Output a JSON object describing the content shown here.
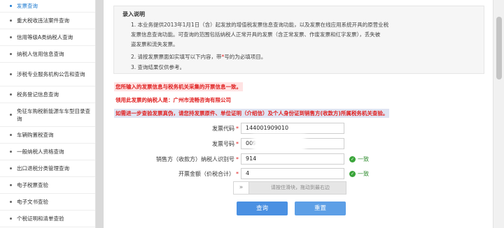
{
  "sidebar": {
    "items": [
      {
        "label": "发票查询",
        "active": true
      },
      {
        "label": "重大税收违法案件查询",
        "active": false
      },
      {
        "label": "信用等级A类纳税人查询",
        "active": false
      },
      {
        "label": "纳税人信用信息查询",
        "active": false
      },
      {
        "label": "涉税专业服务机构公告和查询",
        "active": false
      },
      {
        "label": "税务登记信息查询",
        "active": false
      },
      {
        "label": "免征车购税新能源车车型目录查询",
        "active": false
      },
      {
        "label": "车辆购置税查询",
        "active": false
      },
      {
        "label": "一般纳税人资格查询",
        "active": false
      },
      {
        "label": "出口退税分类管理查询",
        "active": false
      },
      {
        "label": "电子税票查验",
        "active": false
      },
      {
        "label": "电子文书查验",
        "active": false
      },
      {
        "label": "个税证明和清单查验",
        "active": false
      }
    ]
  },
  "notice": {
    "title": "录入说明",
    "line1": "1. 本业务提供2013年1月1日（含）起发放的增值税发票信息查询功能，以及发票在线应用系统开具的原营业税",
    "line2": "发票信息查询功能。可查询的范围包括纳税人正常开具的发票（含正常发票、作废发票和红字发票），丢失被",
    "line3": "盗发票和流失发票。",
    "line4_pre": "2. 请按发票票面如实填写以下内容，带",
    "line4_star": "*",
    "line4_post": "号的为必填项目。",
    "line5": "3. 查询结果仅供参考。"
  },
  "warnings": {
    "w1": "您所输入的发票信息与税务机关采集的开票信息一致。",
    "w2": "领用此发票的纳税人是：广州市流畅咨询有限公司",
    "w3": "如需进一步查验发票真伪，请您持发票原件、单位证明（介绍信）及个人身份证到销售方(收款方)所属税务机关查验。"
  },
  "form": {
    "invoice_code_label": "发票代码",
    "invoice_code_value": "144001909010",
    "invoice_number_label": "发票号码",
    "invoice_number_value": "009",
    "seller_id_label": "销售方（收款方）纳税人识别号",
    "seller_id_value": "914",
    "amount_label": "开票金额（价税合计）",
    "amount_value": "4",
    "required_star": "*",
    "match_text": "一致"
  },
  "slider": {
    "handle_glyph": "»",
    "hint": "请按住滑块，拖动到最右边"
  },
  "buttons": {
    "query": "查询",
    "reset": "重置"
  },
  "colors": {
    "accent": "#4a90e2",
    "warning": "#e02020",
    "ok": "#3aa53a"
  }
}
